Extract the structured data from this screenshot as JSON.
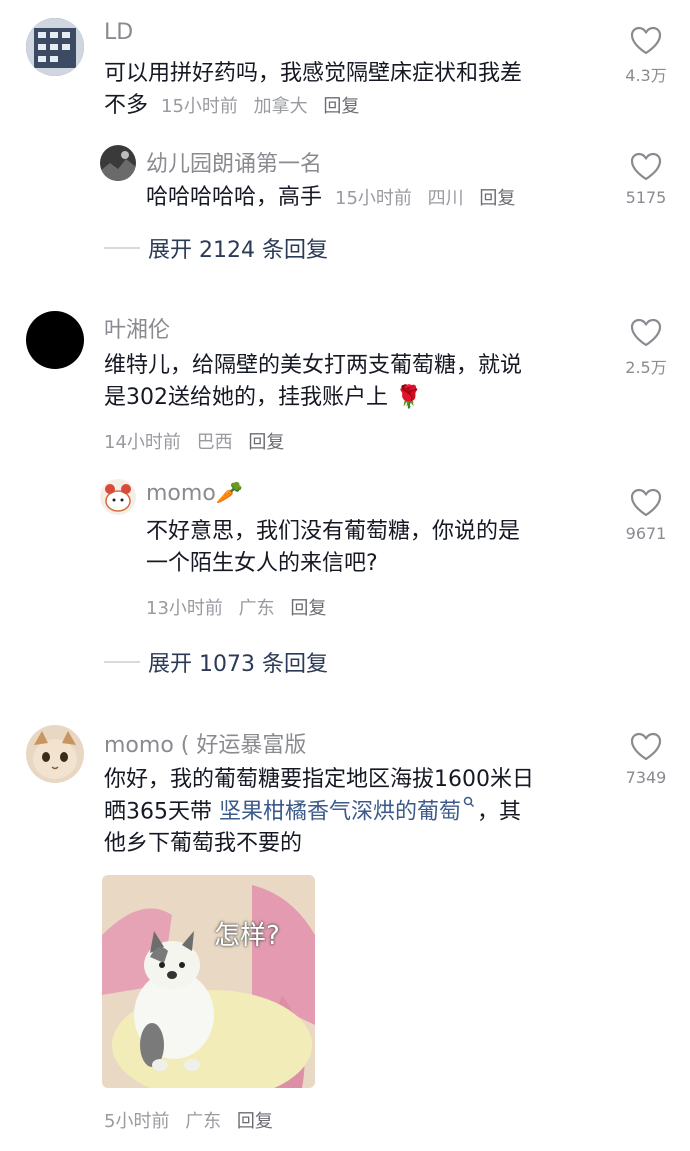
{
  "comments": [
    {
      "user": "LD",
      "text": "可以用拼好药吗，我感觉隔壁床症状和我差不多",
      "line1": "可以用拼好药吗，我感觉隔壁床症状和我差",
      "line2": "不多",
      "time": "15小时前",
      "location": "加拿大",
      "reply_label": "回复",
      "likes": "4.3万",
      "replies": [
        {
          "user": "幼儿园朗诵第一名",
          "text": "哈哈哈哈哈，高手",
          "time": "15小时前",
          "location": "四川",
          "reply_label": "回复",
          "likes": "5175"
        }
      ],
      "expand_label": "展开 2124 条回复"
    },
    {
      "user": "叶湘伦",
      "line1": "维特儿，给隔壁的美女打两支葡萄糖，就说",
      "line2": "是302送给她的，挂我账户上",
      "emoji": "🌹",
      "time": "14小时前",
      "location": "巴西",
      "reply_label": "回复",
      "likes": "2.5万",
      "replies": [
        {
          "user": "momo🥕",
          "line1": "不好意思，我们没有葡萄糖，你说的是",
          "line2": "一个陌生女人的来信吧?",
          "time": "13小时前",
          "location": "广东",
          "reply_label": "回复",
          "likes": "9671"
        }
      ],
      "expand_label": "展开 1073 条回复"
    },
    {
      "user": "momo ( 好运暴富版",
      "line1": "你好，我的葡萄糖要指定地区海拔1600米日",
      "line2_prefix": "晒365天带 ",
      "line2_link": "坚果柑橘香气深烘的葡萄",
      "line2_suffix": "，其",
      "line3": "他乡下葡萄我不要的",
      "image_caption": "怎样?",
      "time": "5小时前",
      "location": "广东",
      "reply_label": "回复",
      "likes": "7349"
    }
  ],
  "colors": {
    "text": "#161823",
    "name": "#8a8b91",
    "meta": "#9a9ba1",
    "expand": "#2b3a55",
    "link": "#3c5a8a"
  }
}
